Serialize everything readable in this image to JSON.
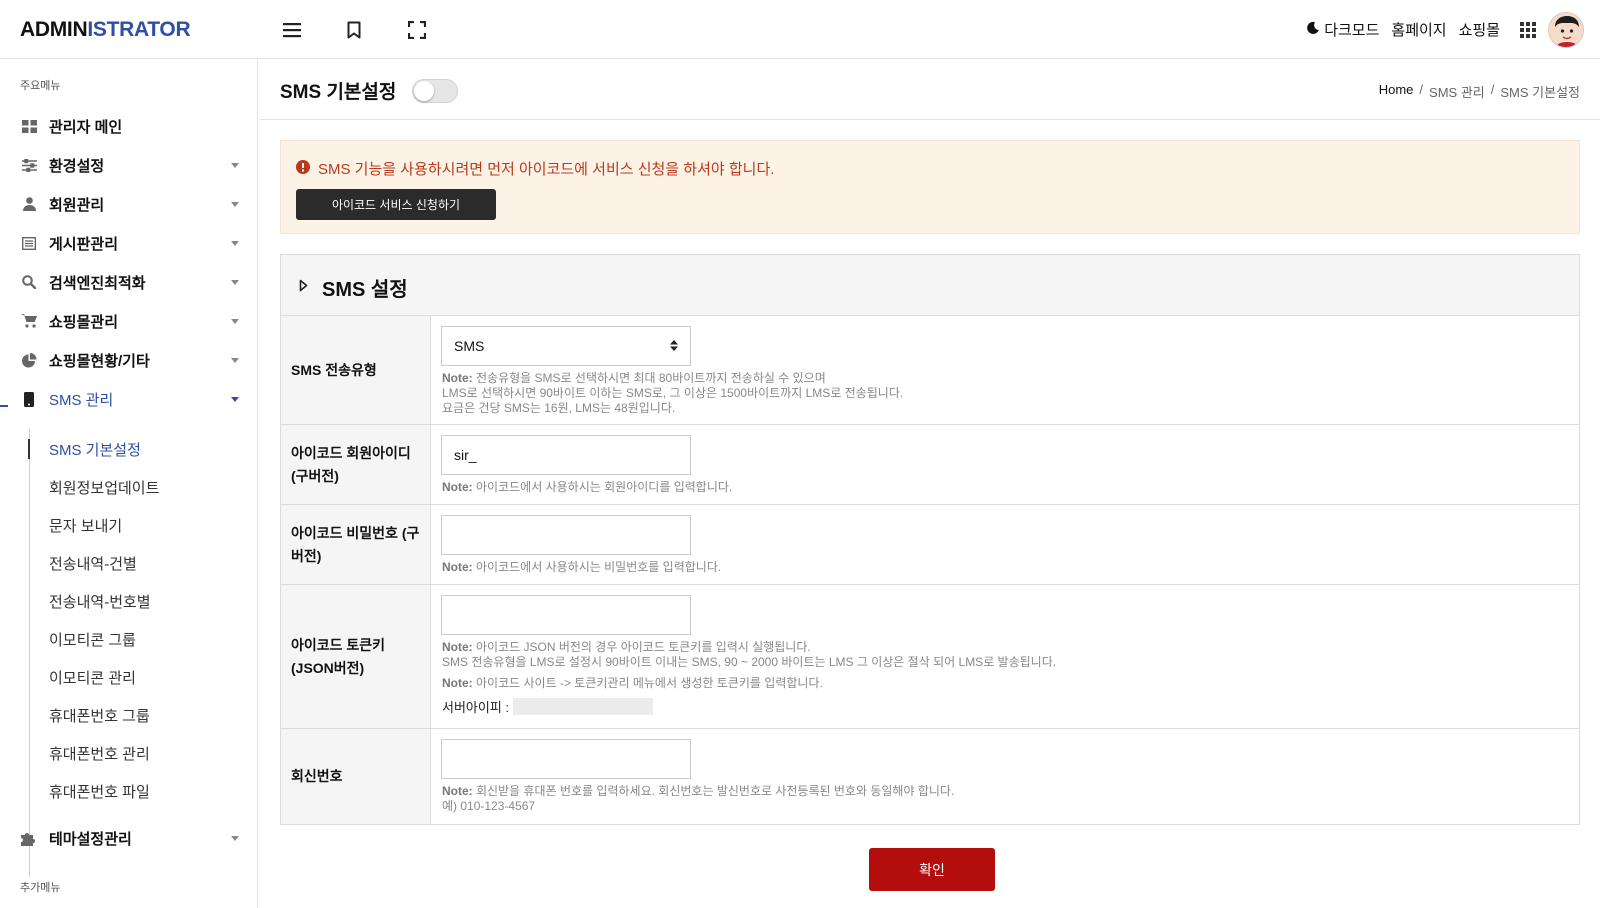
{
  "header": {
    "logo_part1": "ADMIN",
    "logo_part2": "ISTRATOR",
    "darkmode_label": "다크모드",
    "homepage_label": "홈페이지",
    "shop_label": "쇼핑몰"
  },
  "sidebar": {
    "section_main": "주요메뉴",
    "section_extra": "추가메뉴",
    "items": [
      {
        "label": "관리자 메인",
        "icon": "dashboard-icon"
      },
      {
        "label": "환경설정",
        "icon": "sliders-icon"
      },
      {
        "label": "회원관리",
        "icon": "user-icon"
      },
      {
        "label": "게시판관리",
        "icon": "list-icon"
      },
      {
        "label": "검색엔진최적화",
        "icon": "search-icon"
      },
      {
        "label": "쇼핑몰관리",
        "icon": "cart-icon"
      },
      {
        "label": "쇼핑몰현황/기타",
        "icon": "pie-chart-icon"
      },
      {
        "label": "SMS 관리",
        "icon": "mobile-icon"
      },
      {
        "label": "테마설정관리",
        "icon": "puzzle-icon"
      }
    ],
    "sms_sub": [
      "SMS 기본설정",
      "회원정보업데이트",
      "문자 보내기",
      "전송내역-건별",
      "전송내역-번호별",
      "이모티콘 그룹",
      "이모티콘 관리",
      "휴대폰번호 그룹",
      "휴대폰번호 관리",
      "휴대폰번호 파일"
    ]
  },
  "page": {
    "title": "SMS 기본설정",
    "breadcrumb": [
      "Home",
      "/",
      "SMS 관리",
      "/",
      "SMS 기본설정"
    ]
  },
  "alert": {
    "message": "SMS 기능을 사용하시려면 먼저 아이코드에 서비스 신청을 하셔야 합니다.",
    "button": "아이코드 서비스 신청하기"
  },
  "panel": {
    "title": "SMS 설정",
    "rows": {
      "send_type": {
        "label": "SMS 전송유형",
        "value": "SMS",
        "note_prefix": "Note:",
        "note_lines": [
          "전송유형을 SMS로 선택하시면 최대 80바이트까지 전송하실 수 있으며",
          "LMS로 선택하시면 90바이트 이하는 SMS로, 그 이상은 1500바이트까지 LMS로 전송됩니다.",
          "요금은 건당 SMS는 16원, LMS는 48원입니다."
        ]
      },
      "icode_id": {
        "label": "아이코드 회원아이디 (구버전)",
        "value": "sir_",
        "note_prefix": "Note:",
        "note": "아이코드에서 사용하시는 회원아이디를 입력합니다."
      },
      "icode_pw": {
        "label": "아이코드 비밀번호 (구버전)",
        "value": "",
        "note_prefix": "Note:",
        "note": "아이코드에서 사용하시는 비밀번호를 입력합니다."
      },
      "icode_token": {
        "label": "아이코드 토큰키 (JSON버전)",
        "value": "",
        "note_prefix": "Note:",
        "note1": "아이코드 JSON 버전의 경우 아이코드 토큰키를 입력시 실행됩니다.",
        "note1_line2": "SMS 전송유형을 LMS로 설정시 90바이트 이내는 SMS, 90 ~ 2000 바이트는 LMS 그 이상은 절삭 되어 LMS로 발송됩니다.",
        "note2": "아이코드 사이트 -> 토큰키관리 메뉴에서 생성한 토큰키를 입력합니다.",
        "server_ip_label": "서버아이피 :"
      },
      "reply_number": {
        "label": "회신번호",
        "value": "",
        "note_prefix": "Note:",
        "note": "회신받을 휴대폰 번호를 입력하세요. 회신번호는 발신번호로 사전등록된 번호와 동일해야 합니다.",
        "example": "예) 010-123-4567"
      }
    }
  },
  "confirm_button": "확인",
  "colors": {
    "brand_blue": "#2f4fa6",
    "alert_bg": "#fdf2e6",
    "alert_text": "#b83a1a",
    "confirm_red": "#b30d0d"
  }
}
